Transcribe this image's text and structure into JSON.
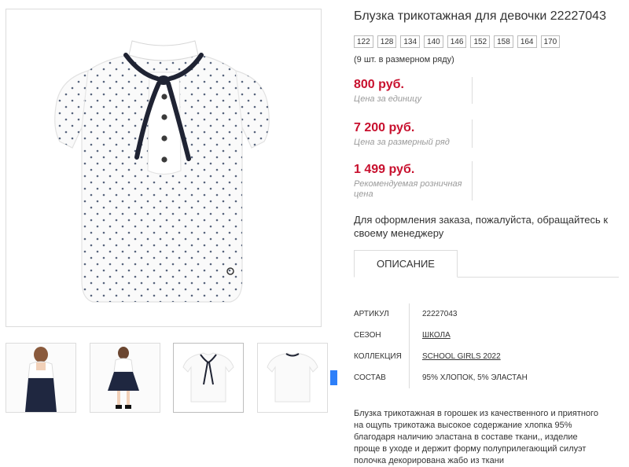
{
  "product": {
    "title": "Блузка трикотажная для девочки 22227043",
    "sizes": [
      "122",
      "128",
      "134",
      "140",
      "146",
      "152",
      "158",
      "164",
      "170"
    ],
    "size_note": "(9 шт. в размерном ряду)",
    "prices": [
      {
        "value": "800 руб.",
        "label": "Цена за единицу"
      },
      {
        "value": "7 200 руб.",
        "label": "Цена за размерный ряд"
      },
      {
        "value": "1 499 руб.",
        "label": "Рекомендуемая розничная цена"
      }
    ],
    "order_note": "Для оформления заказа, пожалуйста, обращайтесь к своему менеджеру"
  },
  "tabs": [
    {
      "label": "Описание",
      "active": true
    }
  ],
  "specs": [
    {
      "key": "Артикул",
      "value": "22227043",
      "link": false
    },
    {
      "key": "Сезон",
      "value": "Школа",
      "link": true
    },
    {
      "key": "Коллекция",
      "value": "SCHOOL GIRLS 2022",
      "link": true
    },
    {
      "key": "Состав",
      "value": "95% Хлопок, 5% Эластан",
      "link": false
    }
  ],
  "description": "Блузка трикотажная в горошек из качественного и приятного на ощупь трикотажа высокое содержание хлопка 95% благодаря наличию эластана в составе ткани,, изделие проще в уходе и держит форму полуприлегающий силуэт полочка декорирована жабо из ткани",
  "gallery": {
    "thumbnails": [
      "model-front",
      "model-back",
      "blouse-front",
      "blouse-back"
    ],
    "active_index": 2
  },
  "colors": {
    "price": "#c8102e",
    "scroll_accent": "#2d7ff9",
    "bow": "#1f2333"
  }
}
